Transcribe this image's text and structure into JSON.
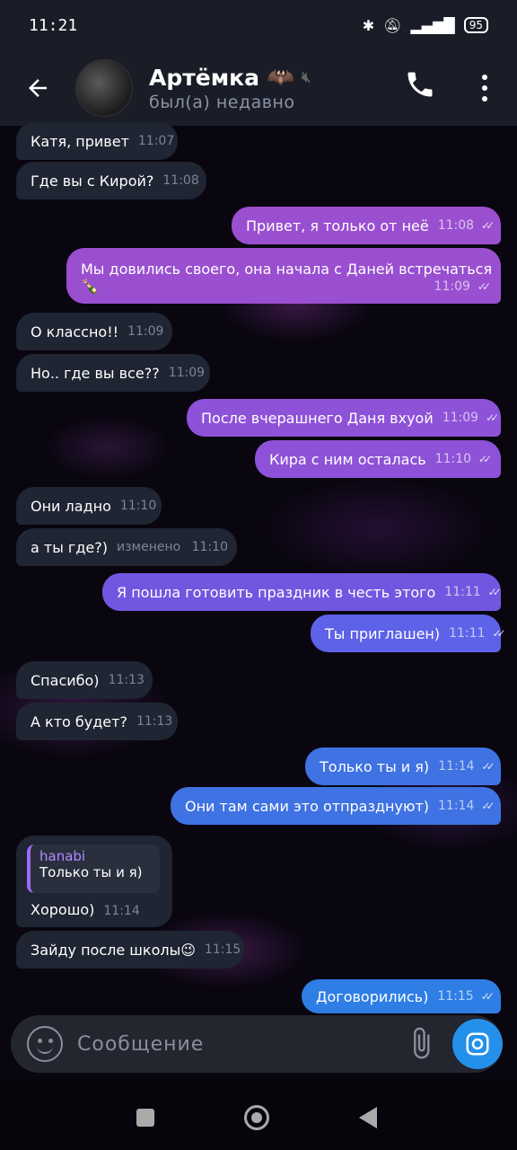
{
  "status_bar": {
    "time": "11:21",
    "battery": "95"
  },
  "header": {
    "name": "Артёмка",
    "status": "был(а) недавно"
  },
  "messages": [
    {
      "text": "Катя, привет",
      "time": "11:07"
    },
    {
      "text": "Где вы с Кирой?",
      "time": "11:08"
    },
    {
      "text": "Привет, я только от неё",
      "time": "11:08"
    },
    {
      "text": "Мы довились своего, она начала с Даней встречаться",
      "emoji": "🍾",
      "time": "11:09"
    },
    {
      "text": "О классно!!",
      "time": "11:09"
    },
    {
      "text": "Но.. где вы все??",
      "time": "11:09"
    },
    {
      "text": "После вчерашнего Даня вхуой",
      "time": "11:09"
    },
    {
      "text": "Кира с ним осталась",
      "time": "11:10"
    },
    {
      "text": "Они ладно",
      "time": "11:10"
    },
    {
      "text": "а ты где?)",
      "edited": "изменено",
      "time": "11:10"
    },
    {
      "text": "Я пошла готовить праздник в честь этого",
      "time": "11:11"
    },
    {
      "text": "Ты приглашен)",
      "time": "11:11"
    },
    {
      "text": "Спасибо)",
      "time": "11:13"
    },
    {
      "text": "А кто будет?",
      "time": "11:13"
    },
    {
      "text": "Только ты и я)",
      "time": "11:14"
    },
    {
      "text": "Они там сами это отпразднуют)",
      "time": "11:14"
    },
    {
      "reply_name": "hanabi",
      "reply_text": "Только ты и я)",
      "text": "Хорошо)",
      "time": "11:14"
    },
    {
      "text": "Зайду после школы😉",
      "time": "11:15"
    },
    {
      "text": "Договорились)",
      "time": "11:15"
    }
  ],
  "composer": {
    "placeholder": "Сообщение"
  },
  "colors": {
    "header_bg": "#1a1d27",
    "incoming_bubble": "#1f2532",
    "accent_blue": "#2590ea",
    "outgoing_purple": "#9a4fd0"
  },
  "icons": [
    "back-arrow-icon",
    "mute-icon",
    "phone-icon",
    "more-vertical-icon",
    "emoji-icon",
    "attach-icon",
    "camera-icon"
  ]
}
